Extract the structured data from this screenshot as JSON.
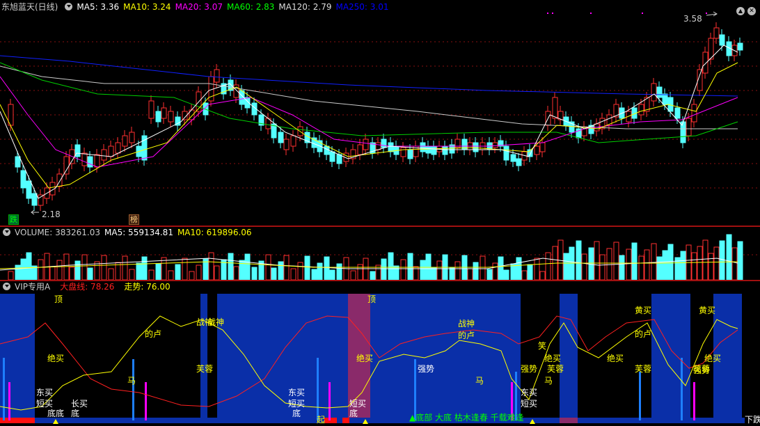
{
  "main": {
    "stock_name": "东旭蓝天(日线)",
    "indicators": [
      {
        "label": "MA5: 3.36",
        "color": "#ffffff"
      },
      {
        "label": "MA10: 3.24",
        "color": "#ffff00"
      },
      {
        "label": "MA20: 3.07",
        "color": "#ff00ff"
      },
      {
        "label": "MA60: 2.83",
        "color": "#00ff00"
      },
      {
        "label": "MA120: 2.79",
        "color": "#dddddd"
      },
      {
        "label": "MA250: 3.01",
        "color": "#0000ff"
      }
    ],
    "high_label": "3.58",
    "low_label": "2.18",
    "badge_die": "跌",
    "badge_bang": "榜"
  },
  "volume": {
    "title": "VOLUME: 383261.03",
    "ma5": "MA5: 559134.81",
    "ma10": "MA10: 619896.06"
  },
  "vip": {
    "title": "VIP专用A",
    "dapan": "大盘线: 78.26",
    "zoushi": "走势: 76.00",
    "corner": "下跌",
    "labels": [
      {
        "t": "顶",
        "c": "y"
      },
      {
        "t": "顶",
        "c": "y"
      },
      {
        "t": "绝买",
        "c": "y"
      },
      {
        "t": "绝买",
        "c": "y"
      },
      {
        "t": "绝买",
        "c": "y"
      },
      {
        "t": "绝买",
        "c": "y"
      },
      {
        "t": "绝买",
        "c": "y"
      },
      {
        "t": "的卢",
        "c": "y"
      },
      {
        "t": "的卢",
        "c": "y"
      },
      {
        "t": "的卢",
        "c": "y"
      },
      {
        "t": "战神",
        "c": "y"
      },
      {
        "t": "战神",
        "c": "y"
      },
      {
        "t": "战神",
        "c": "y"
      },
      {
        "t": "芙蓉",
        "c": "y"
      },
      {
        "t": "芙蓉",
        "c": "y"
      },
      {
        "t": "芙蓉",
        "c": "y"
      },
      {
        "t": "芙蓉",
        "c": "y"
      },
      {
        "t": "马",
        "c": "y"
      },
      {
        "t": "马",
        "c": "y"
      },
      {
        "t": "马",
        "c": "y"
      },
      {
        "t": "强势",
        "c": "w"
      },
      {
        "t": "强势",
        "c": "y"
      },
      {
        "t": "强势",
        "c": "y"
      },
      {
        "t": "黄买",
        "c": "y"
      },
      {
        "t": "黄买",
        "c": "y"
      },
      {
        "t": "笑",
        "c": "y"
      },
      {
        "t": "东买",
        "c": "w"
      },
      {
        "t": "短买",
        "c": "w"
      },
      {
        "t": "长买",
        "c": "w"
      },
      {
        "t": "底",
        "c": "w"
      },
      {
        "t": "底底",
        "c": "w"
      },
      {
        "t": "东买",
        "c": "w"
      },
      {
        "t": "短买",
        "c": "w"
      },
      {
        "t": "底",
        "c": "w"
      },
      {
        "t": "短买",
        "c": "w"
      },
      {
        "t": "底",
        "c": "w"
      },
      {
        "t": "东买",
        "c": "w"
      },
      {
        "t": "短买",
        "c": "w"
      },
      {
        "t": "起",
        "c": "y"
      }
    ],
    "bottom_text": "▲底部 大底 枯木逢春 千载难逢"
  }
}
